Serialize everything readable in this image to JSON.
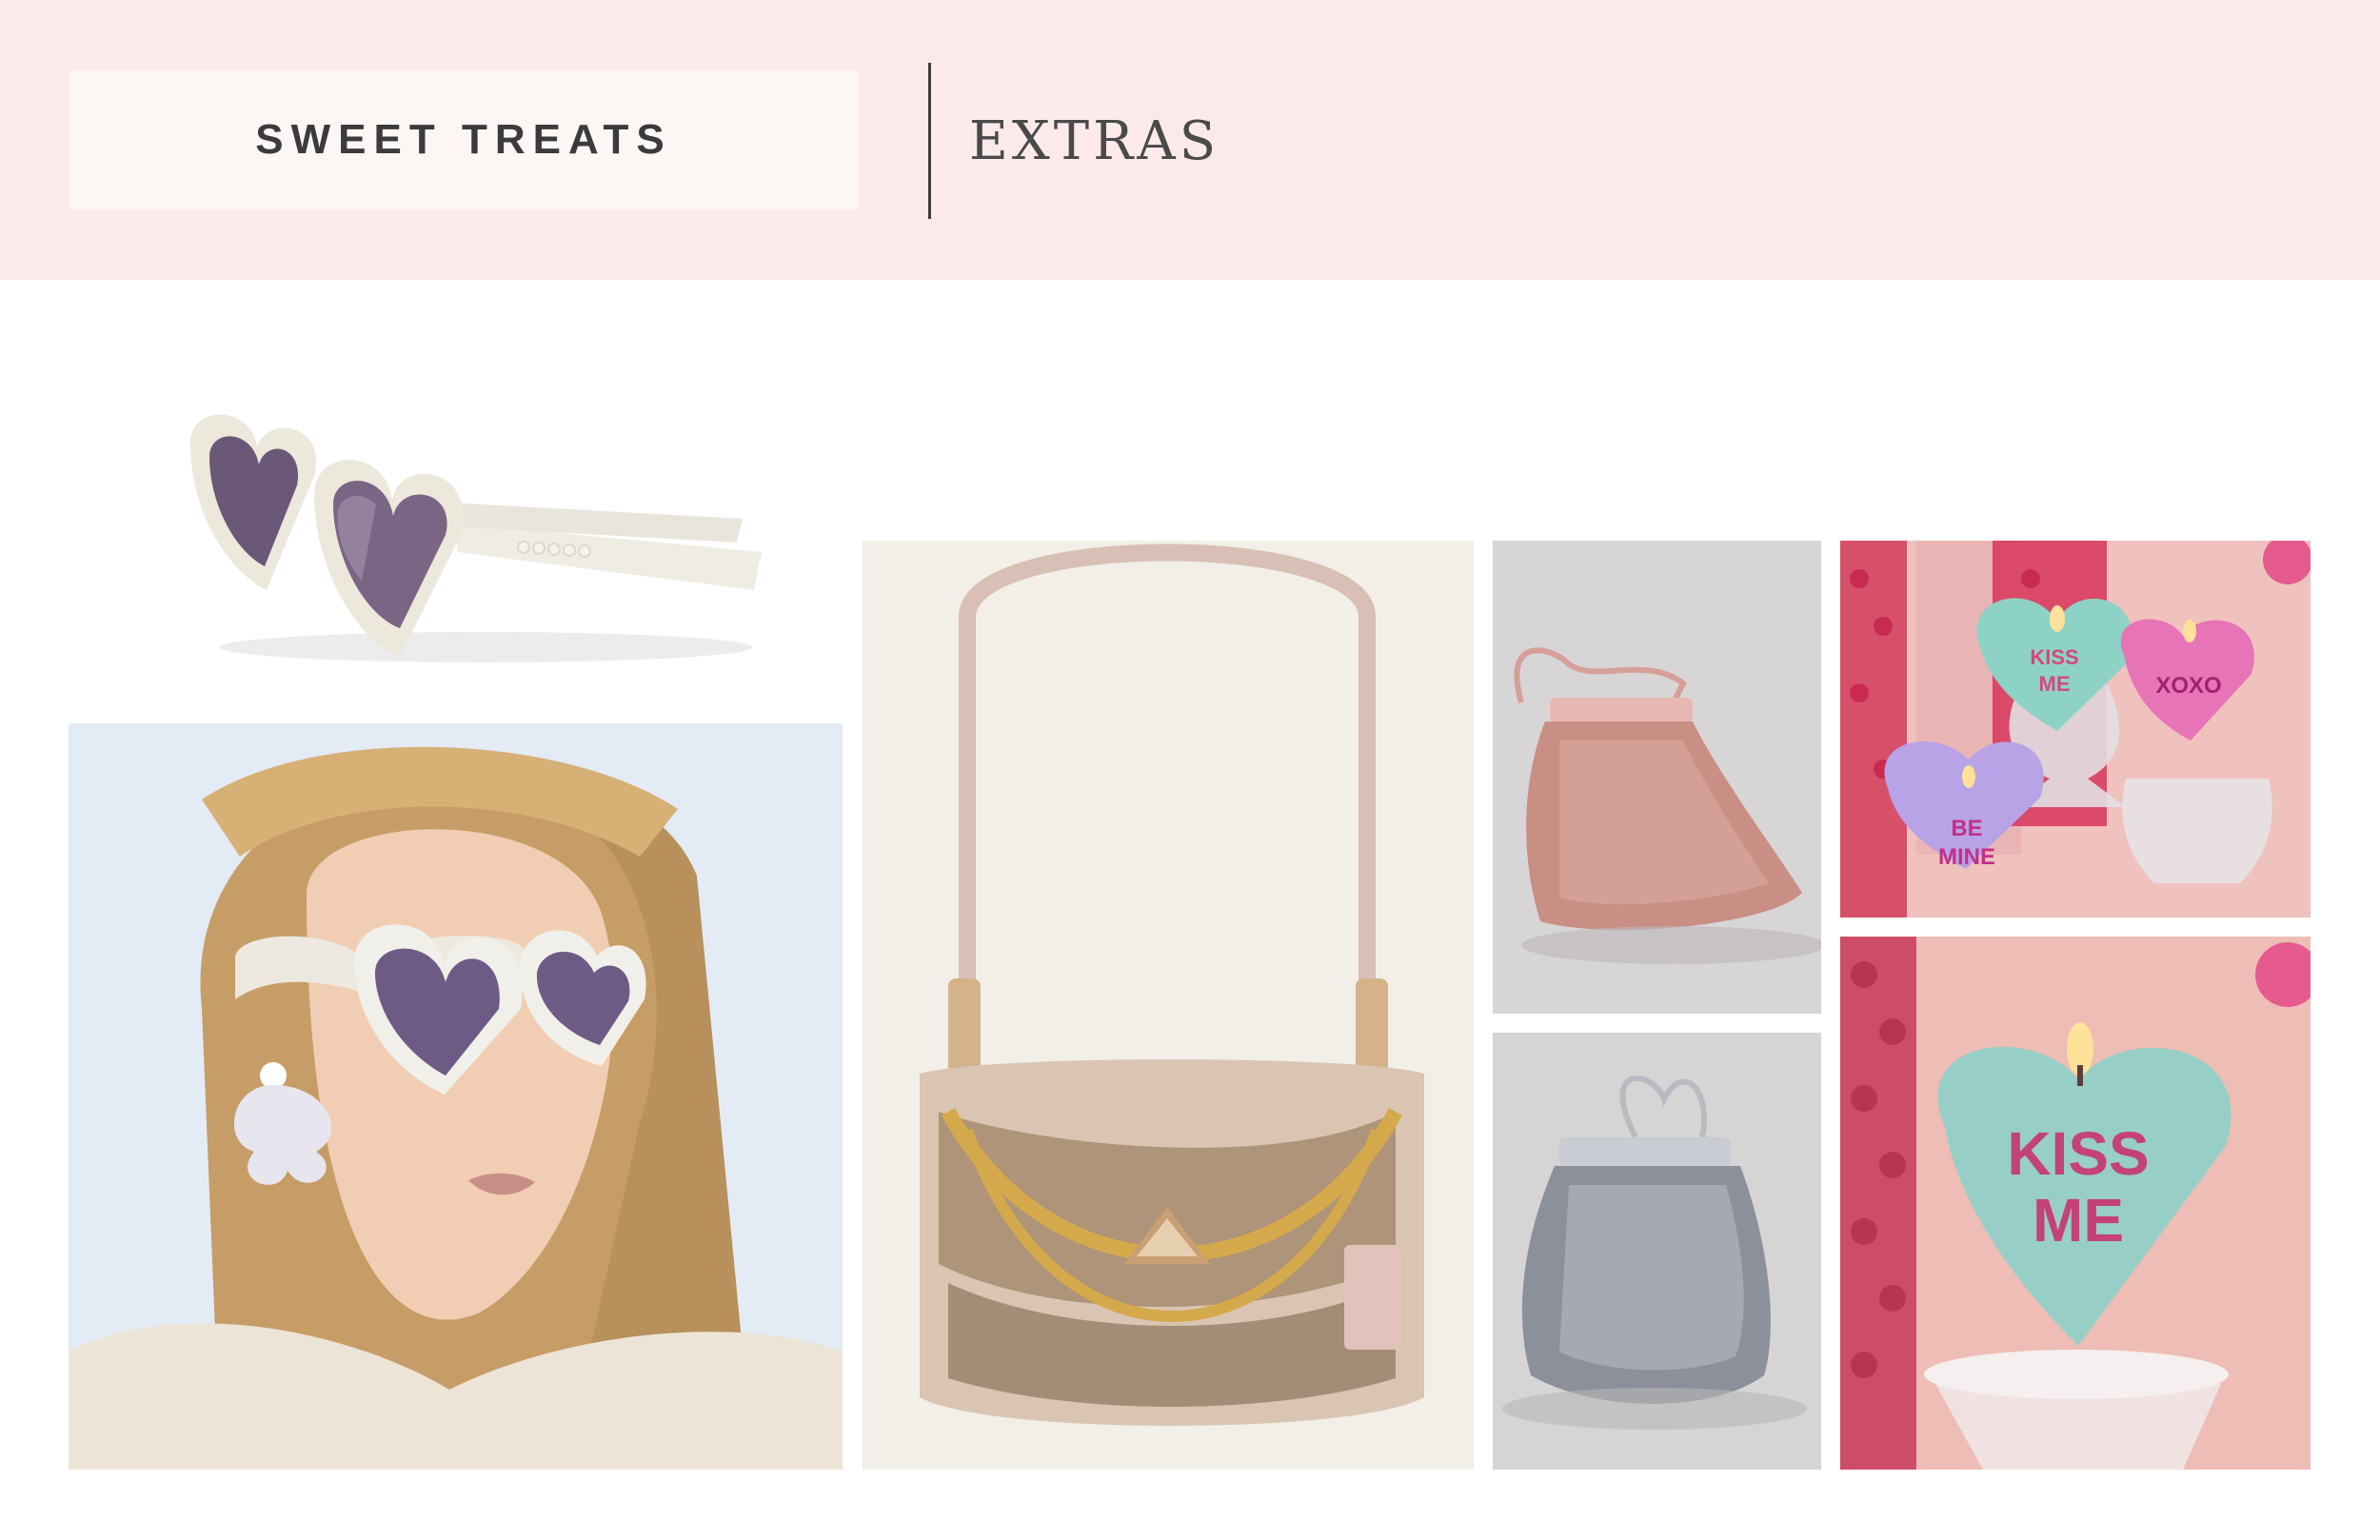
{
  "header": {
    "title": "SWEET TREATS",
    "section": "EXTRAS"
  },
  "colors": {
    "header_background": "#fceaea",
    "title_box_background": "#fcf6f5",
    "text": "#3b3b3b"
  },
  "products": [
    {
      "name": "heart-sunglasses"
    },
    {
      "name": "model-wearing-heart-sunglasses"
    },
    {
      "name": "sequin-shoulder-bag"
    },
    {
      "name": "pink-mesh-frame-bag"
    },
    {
      "name": "silver-mesh-frame-bag"
    },
    {
      "name": "candy-heart-candles-group",
      "texts": [
        "KISS",
        "ME",
        "XOXO",
        "BE",
        "MINE"
      ]
    },
    {
      "name": "kiss-me-heart-candle",
      "texts": [
        "KISS",
        "ME"
      ]
    }
  ]
}
